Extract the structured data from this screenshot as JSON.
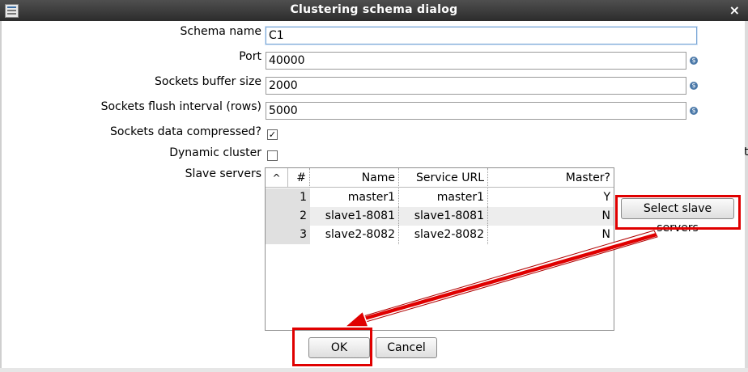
{
  "window": {
    "title": "Clustering schema dialog",
    "close_glyph": "×",
    "app_icon": "dialog-icon"
  },
  "form": {
    "schema_name": {
      "label": "Schema name",
      "value": "C1"
    },
    "port": {
      "label": "Port",
      "value": "40000"
    },
    "buffer_size": {
      "label": "Sockets buffer size",
      "value": "2000"
    },
    "flush_interval": {
      "label": "Sockets flush interval (rows)",
      "value": "5000"
    },
    "compressed": {
      "label": "Sockets data compressed?",
      "checked": true
    },
    "dynamic": {
      "label": "Dynamic cluster",
      "checked": false
    },
    "slave_servers_label": "Slave servers",
    "variable_icon": "variable-dollar-icon"
  },
  "slaves_table": {
    "sort_glyph": "^",
    "columns": [
      "#",
      "Name",
      "Service URL",
      "Master?"
    ],
    "rows": [
      {
        "num": "1",
        "name": "master1",
        "url": "master1",
        "master": "Y"
      },
      {
        "num": "2",
        "name": "slave1-8081",
        "url": "slave1-8081",
        "master": "N"
      },
      {
        "num": "3",
        "name": "slave2-8082",
        "url": "slave2-8082",
        "master": "N"
      }
    ]
  },
  "buttons": {
    "select_slaves": "Select slave servers",
    "ok": "OK",
    "cancel": "Cancel"
  },
  "annotation": {
    "color": "#e00000"
  },
  "edge_text": "t"
}
